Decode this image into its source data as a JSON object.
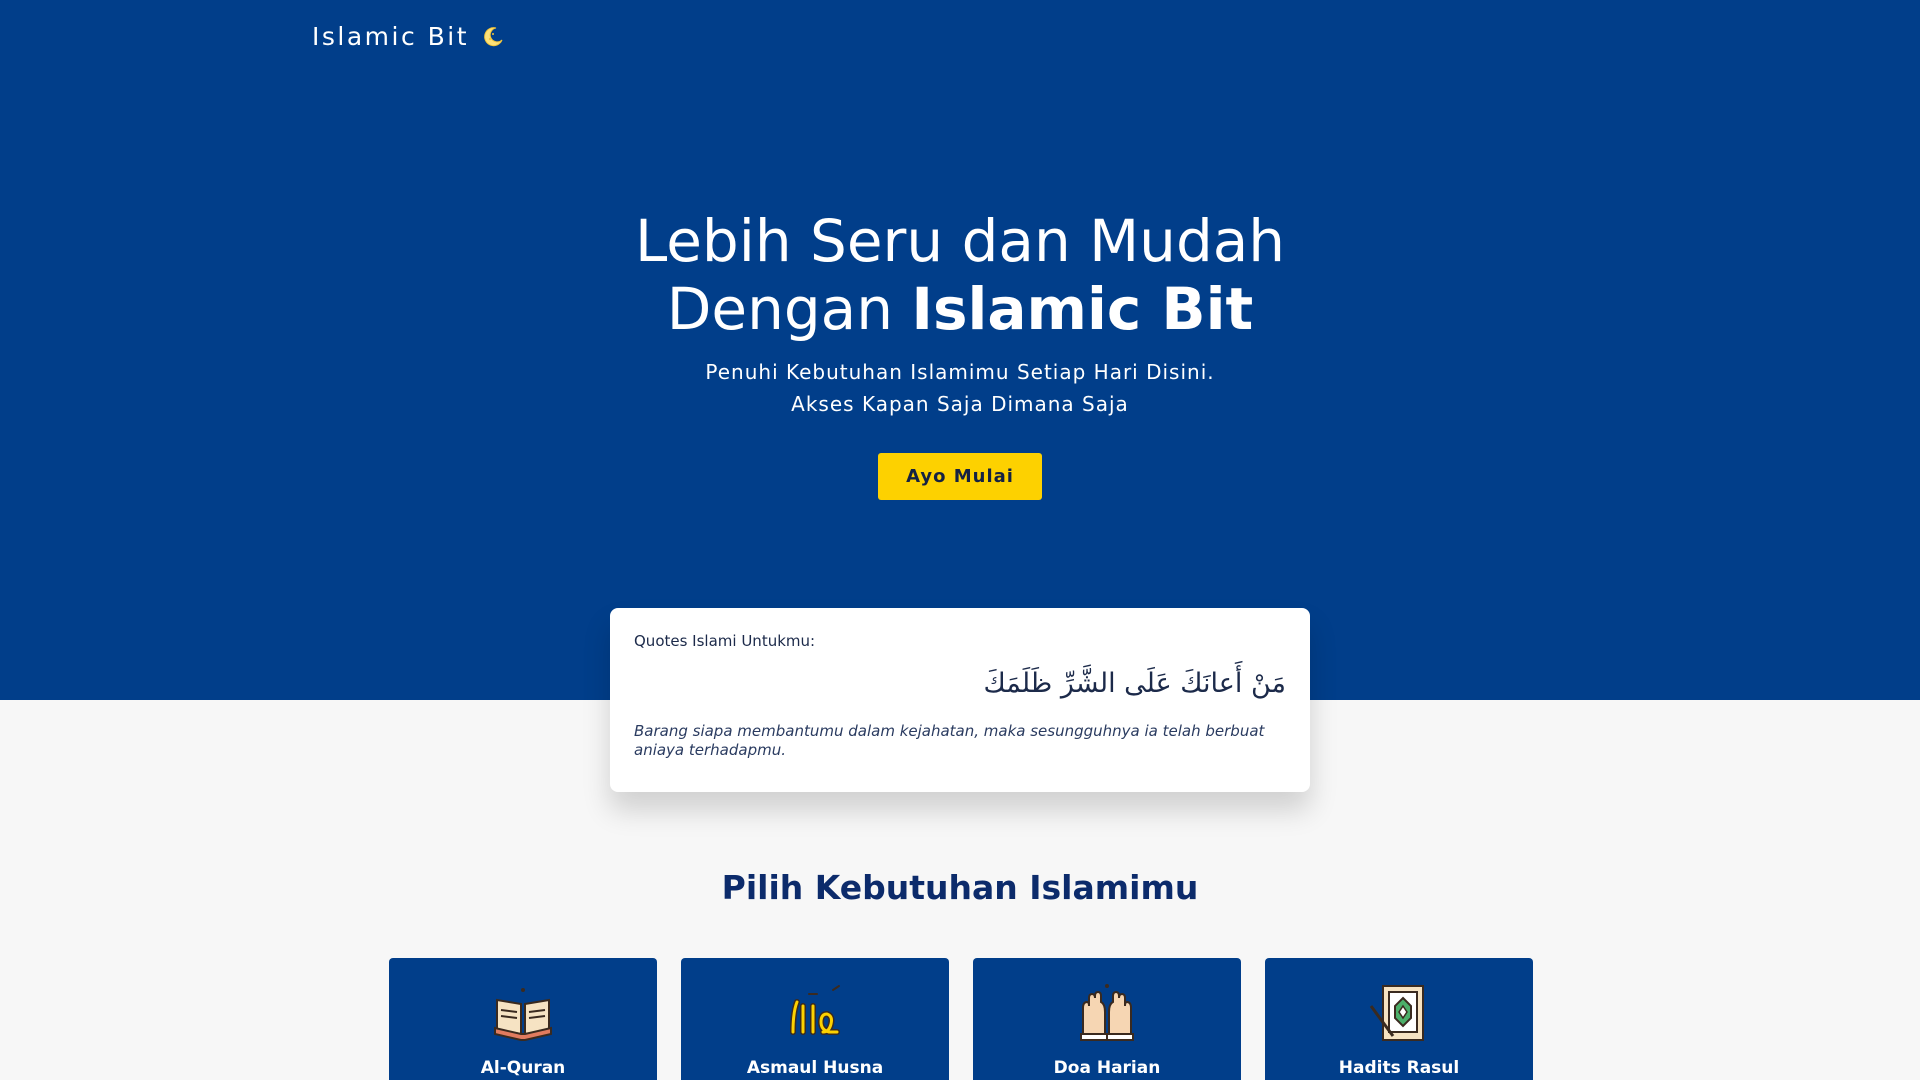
{
  "brand": {
    "name": "Islamic Bit",
    "icon": "crescent-moon-icon"
  },
  "hero": {
    "title_line1": "Lebih Seru dan Mudah",
    "title_line2_prefix": "Dengan ",
    "title_line2_bold": "Islamic Bit",
    "subtitle_line1": "Penuhi Kebutuhan Islamimu Setiap Hari Disini.",
    "subtitle_line2": "Akses Kapan Saja Dimana Saja",
    "cta_label": "Ayo Mulai"
  },
  "quote": {
    "label": "Quotes Islami Untukmu:",
    "arabic": "مَنْ أَعانَكَ عَلَى الشَّرِّ ظَلَمَكَ",
    "translation": "Barang siapa membantumu dalam kejahatan, maka sesungguhnya ia telah berbuat aniaya terhadapmu."
  },
  "section": {
    "title": "Pilih Kebutuhan Islamimu"
  },
  "cards": [
    {
      "label": "Al-Quran",
      "icon": "quran-book-icon"
    },
    {
      "label": "Asmaul Husna",
      "icon": "allah-calligraphy-icon"
    },
    {
      "label": "Doa Harian",
      "icon": "praying-hands-icon"
    },
    {
      "label": "Hadits Rasul",
      "icon": "hadith-book-icon"
    }
  ],
  "colors": {
    "primary_blue": "#013e8a",
    "accent_yellow": "#fdd100",
    "page_background": "#f7f7f7",
    "heading_navy": "#0c2b6b"
  }
}
